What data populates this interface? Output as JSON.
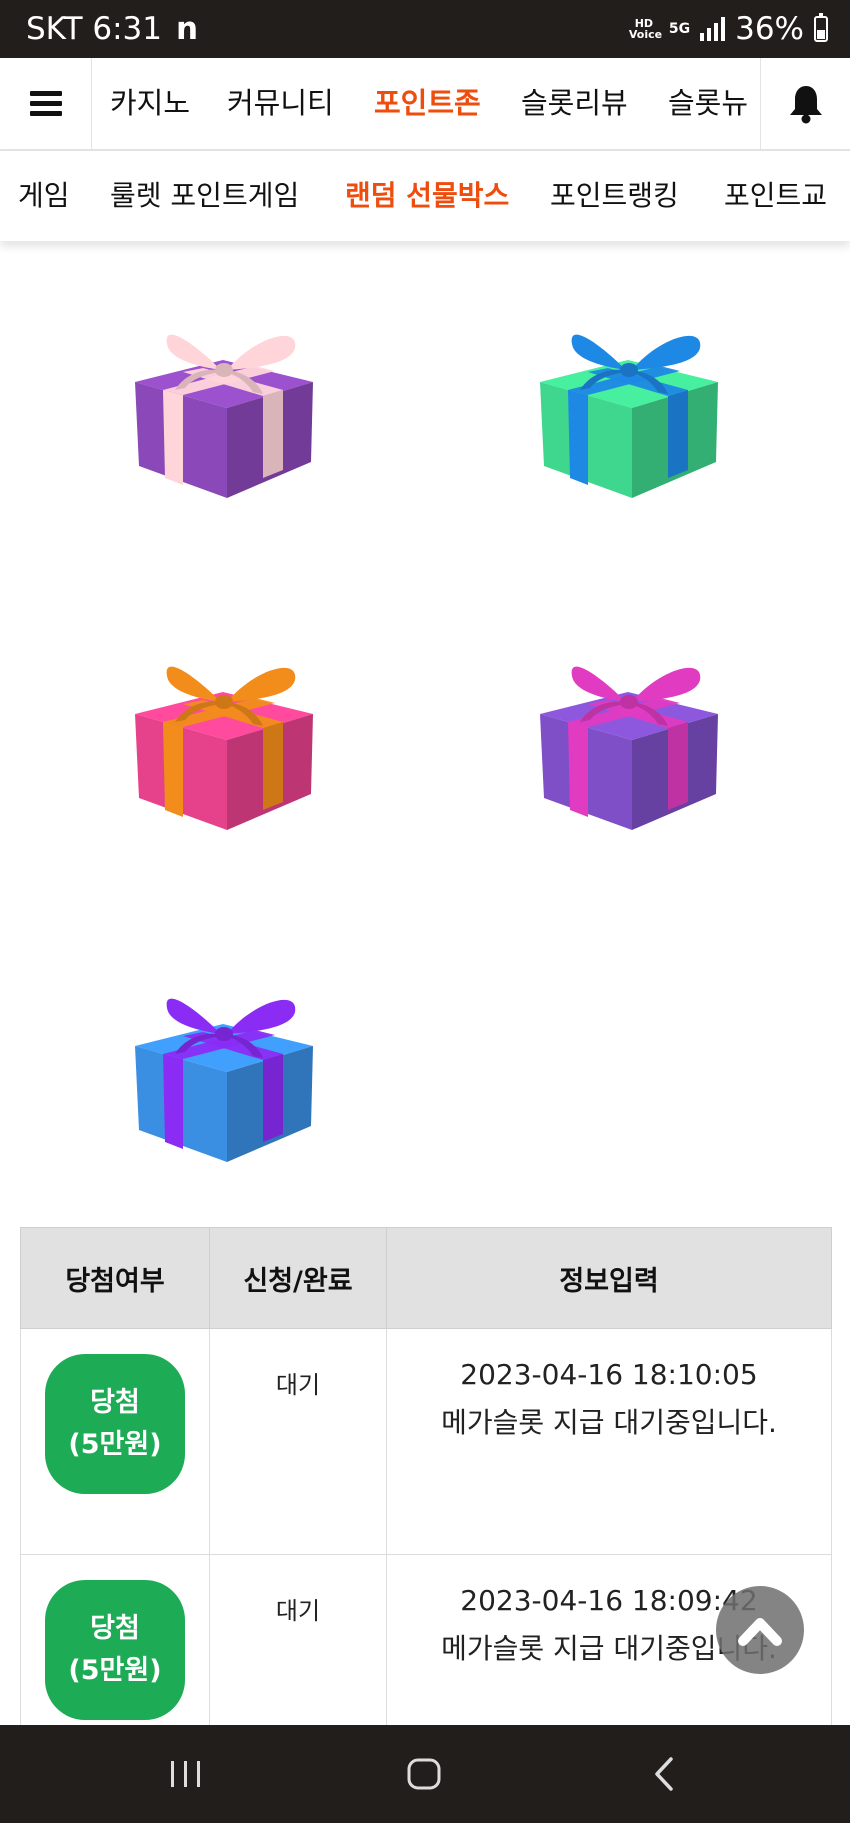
{
  "status_bar": {
    "carrier_time": "SKT 6:31",
    "app_icon": "n",
    "hd_voice": "HD Voice",
    "network": "5G",
    "battery_text": "36%"
  },
  "nav": {
    "menu_icon": "hamburger-icon",
    "bell_icon": "bell-icon",
    "items": [
      "카지노",
      "커뮤니티",
      "포인트존",
      "슬롯리뷰",
      "슬롯뉴"
    ],
    "active_index": 2,
    "active_color": "#ee4d0e"
  },
  "sub_nav": {
    "items": [
      "게임",
      "룰렛 포인트게임",
      "랜덤 선물박스",
      "포인트랭킹",
      "포인트교"
    ],
    "active_index": 2
  },
  "gifts": [
    {
      "box": "#8b48b8",
      "ribbon": "#ffd5da"
    },
    {
      "box": "#3fd68e",
      "ribbon": "#1e88e5"
    },
    {
      "box": "#e6428c",
      "ribbon": "#f28c1a"
    },
    {
      "box": "#7e4fc6",
      "ribbon": "#e03bc1"
    },
    {
      "box": "#3a8fe2",
      "ribbon": "#8b2cf5"
    }
  ],
  "table": {
    "headers": [
      "당첨여부",
      "신청/완료",
      "정보입력"
    ],
    "rows": [
      {
        "badge_line1": "당첨",
        "badge_line2": "(5만원)",
        "status": "대기",
        "datetime": "2023-04-16 18:10:05",
        "message": "메가슬롯 지급 대기중입니다."
      },
      {
        "badge_line1": "당첨",
        "badge_line2": "(5만원)",
        "status": "대기",
        "datetime": "2023-04-16 18:09:42",
        "message": "메가슬롯 지급 대기중입니다."
      }
    ],
    "badge_color": "#1dac55"
  },
  "scroll_top_icon": "chevron-up-icon",
  "system_nav": {
    "recent_icon": "recent-apps-icon",
    "home_icon": "home-icon",
    "back_icon": "back-icon"
  }
}
